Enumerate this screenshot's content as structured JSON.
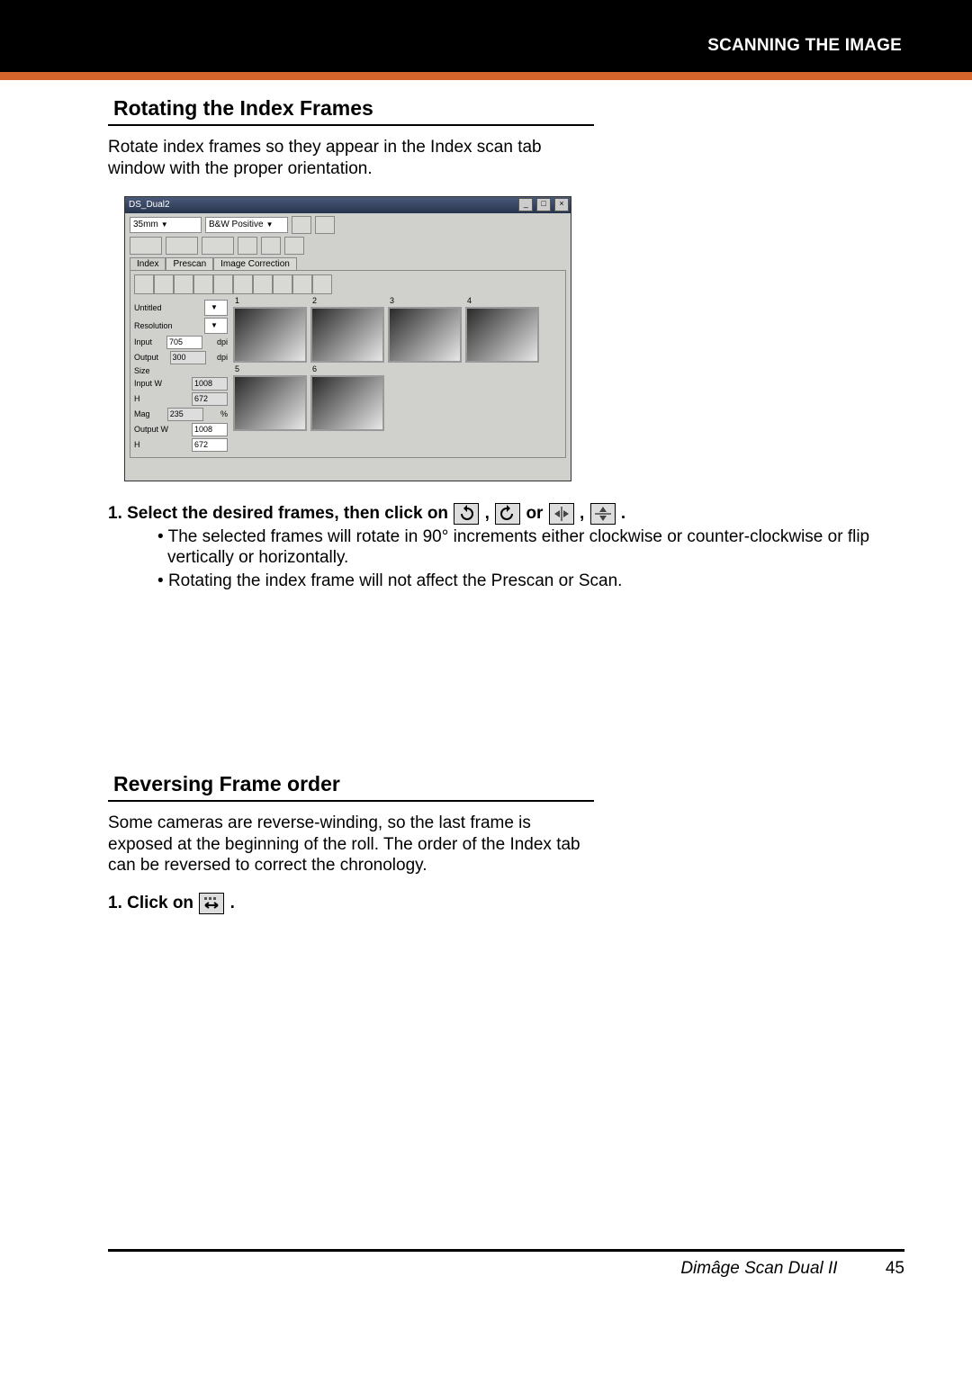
{
  "header": {
    "title": "SCANNING THE IMAGE"
  },
  "section1": {
    "heading": "Rotating the Index Frames",
    "intro": "Rotate index frames so they appear in the Index scan tab window with the proper orientation.",
    "step1_lead": "1.  Select the desired frames, then click on ",
    "sep1": ", ",
    "sep2": "  or  ",
    "sep3": ", ",
    "tail": " .",
    "bullet1": "The selected frames will rotate in 90° increments either clockwise or counter-clockwise or flip vertically or horizontally.",
    "bullet2": "Rotating the index frame will not affect the Prescan or Scan."
  },
  "section2": {
    "heading": "Reversing Frame order",
    "intro": "Some cameras are reverse-winding, so the last frame is exposed at the beginning of the roll. The order of the Index tab can be reversed to correct the chronology.",
    "step1_lead": "1.  Click on ",
    "tail": " ."
  },
  "screenshot": {
    "title": "DS_Dual2",
    "film_dd": "35mm",
    "type_dd": "B&W Positive",
    "tabs": [
      "Index",
      "Prescan",
      "Image Correction"
    ],
    "side": {
      "untitled": "Untitled",
      "resolution": "Resolution",
      "input_lbl": "Input",
      "input_val": "705",
      "dpi": "dpi",
      "output_lbl": "Output",
      "output_val": "300",
      "size": "Size",
      "inputw_lbl": "Input W",
      "inputw_val": "1008",
      "h_lbl": "H",
      "h_val": "672",
      "mag_lbl": "Mag",
      "mag_val": "235",
      "pct": "%",
      "outputw_lbl": "Output W",
      "outputw_val": "1008",
      "h2_val": "672"
    },
    "thumbs": [
      "1",
      "2",
      "3",
      "4",
      "5",
      "6"
    ]
  },
  "footer": {
    "product": "Dimâge Scan Dual II",
    "page": "45"
  }
}
